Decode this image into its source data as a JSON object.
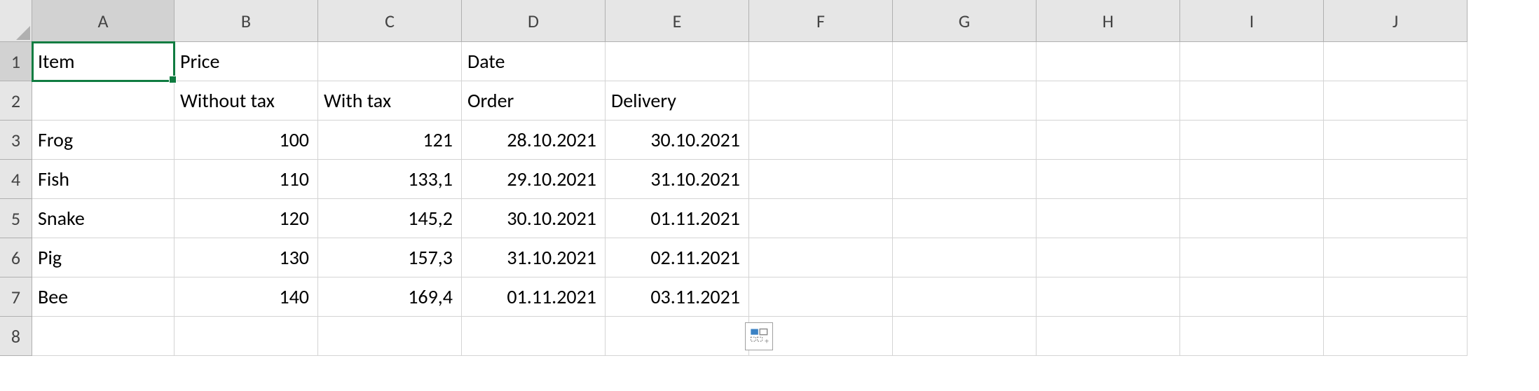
{
  "columns": [
    "A",
    "B",
    "C",
    "D",
    "E",
    "F",
    "G",
    "H",
    "I",
    "J"
  ],
  "row_numbers": [
    "1",
    "2",
    "3",
    "4",
    "5",
    "6",
    "7",
    "8"
  ],
  "selected": {
    "row": 0,
    "col": 0
  },
  "headers": {
    "r1": {
      "A": "Item",
      "B": "Price",
      "D": "Date"
    },
    "r2": {
      "B": "Without tax",
      "C": "With tax",
      "D": "Order",
      "E": "Delivery"
    }
  },
  "data": [
    {
      "item": "Frog",
      "price_no_tax": "100",
      "price_with_tax": "121",
      "order": "28.10.2021",
      "delivery": "30.10.2021"
    },
    {
      "item": "Fish",
      "price_no_tax": "110",
      "price_with_tax": "133,1",
      "order": "29.10.2021",
      "delivery": "31.10.2021"
    },
    {
      "item": "Snake",
      "price_no_tax": "120",
      "price_with_tax": "145,2",
      "order": "30.10.2021",
      "delivery": "01.11.2021"
    },
    {
      "item": "Pig",
      "price_no_tax": "130",
      "price_with_tax": "157,3",
      "order": "31.10.2021",
      "delivery": "02.11.2021"
    },
    {
      "item": "Bee",
      "price_no_tax": "140",
      "price_with_tax": "169,4",
      "order": "01.11.2021",
      "delivery": "03.11.2021"
    }
  ],
  "chart_data": {
    "type": "table",
    "title": "",
    "columns": [
      "Item",
      "Price Without tax",
      "Price With tax",
      "Date Order",
      "Date Delivery"
    ],
    "rows": [
      [
        "Frog",
        100,
        121,
        "28.10.2021",
        "30.10.2021"
      ],
      [
        "Fish",
        110,
        133.1,
        "29.10.2021",
        "31.10.2021"
      ],
      [
        "Snake",
        120,
        145.2,
        "30.10.2021",
        "01.11.2021"
      ],
      [
        "Pig",
        130,
        157.3,
        "31.10.2021",
        "02.11.2021"
      ],
      [
        "Bee",
        140,
        169.4,
        "01.11.2021",
        "03.11.2021"
      ]
    ]
  }
}
